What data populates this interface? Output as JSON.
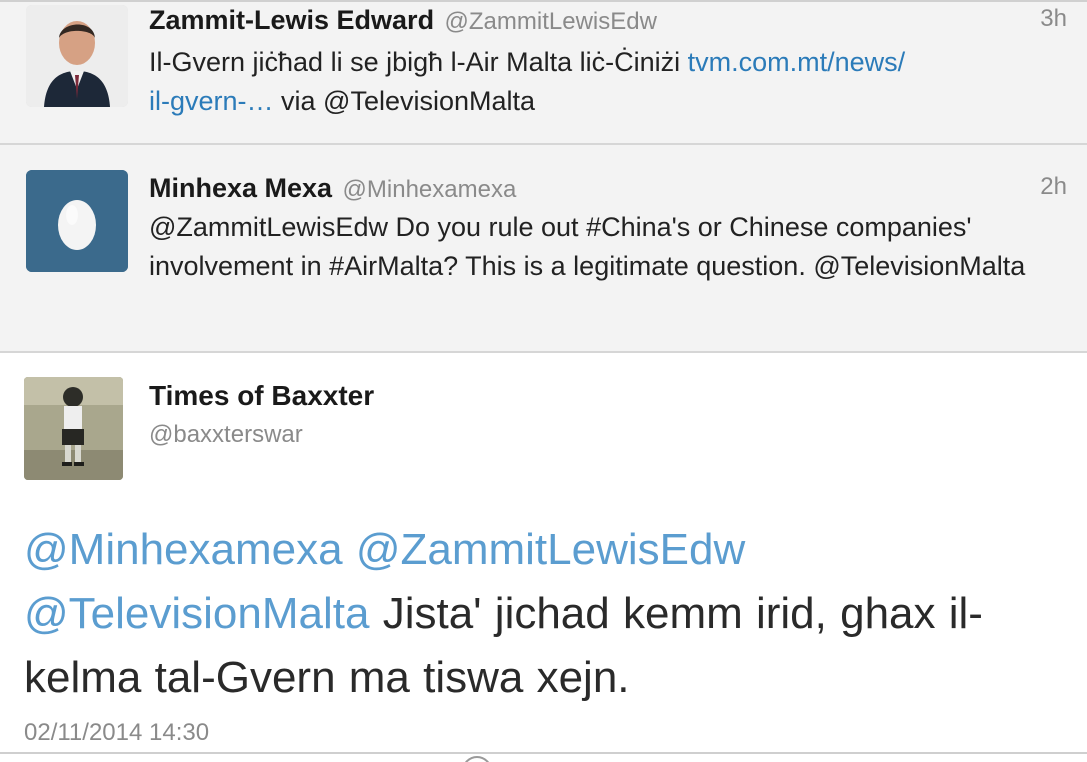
{
  "timeline": {
    "tweets": [
      {
        "name": "Zammit-Lewis Edward",
        "handle": "@ZammitLewisEdw",
        "time": "3h",
        "text_before_link": "Il-Gvern jiċħad li se jbigħ l-Air Malta liċ-Ċiniżi ",
        "link_line1": "tvm.com.mt/news/",
        "link_line2": "il-gvern-…",
        "text_after_link": " via @TelevisionMalta",
        "avatar_icon": "user-photo-icon"
      },
      {
        "name": "Minhexa Mexa",
        "handle": "@Minhexamexa",
        "time": "2h",
        "text": "@ZammitLewisEdw Do you rule out #China's or Chinese companies' involvement in #AirMalta? This is a legitimate question. @TelevisionMalta",
        "avatar_icon": "default-egg-avatar-icon"
      }
    ]
  },
  "detail": {
    "name": "Times of Baxxter",
    "handle": "@baxxterswar",
    "mention1": "@Minhexamexa",
    "mention2": "@ZammitLewisEdw",
    "mention3": "@TelevisionMalta",
    "text": " Jista' jichad kemm irid, ghax il-kelma tal-Gvern ma tiswa xejn.",
    "timestamp": "02/11/2014 14:30",
    "avatar_icon": "vintage-photo-avatar-icon"
  },
  "colors": {
    "link": "#2b7bb9",
    "mention": "#5b9dd0",
    "muted": "#8a8a8a",
    "compact_bg": "#f3f3f3"
  }
}
